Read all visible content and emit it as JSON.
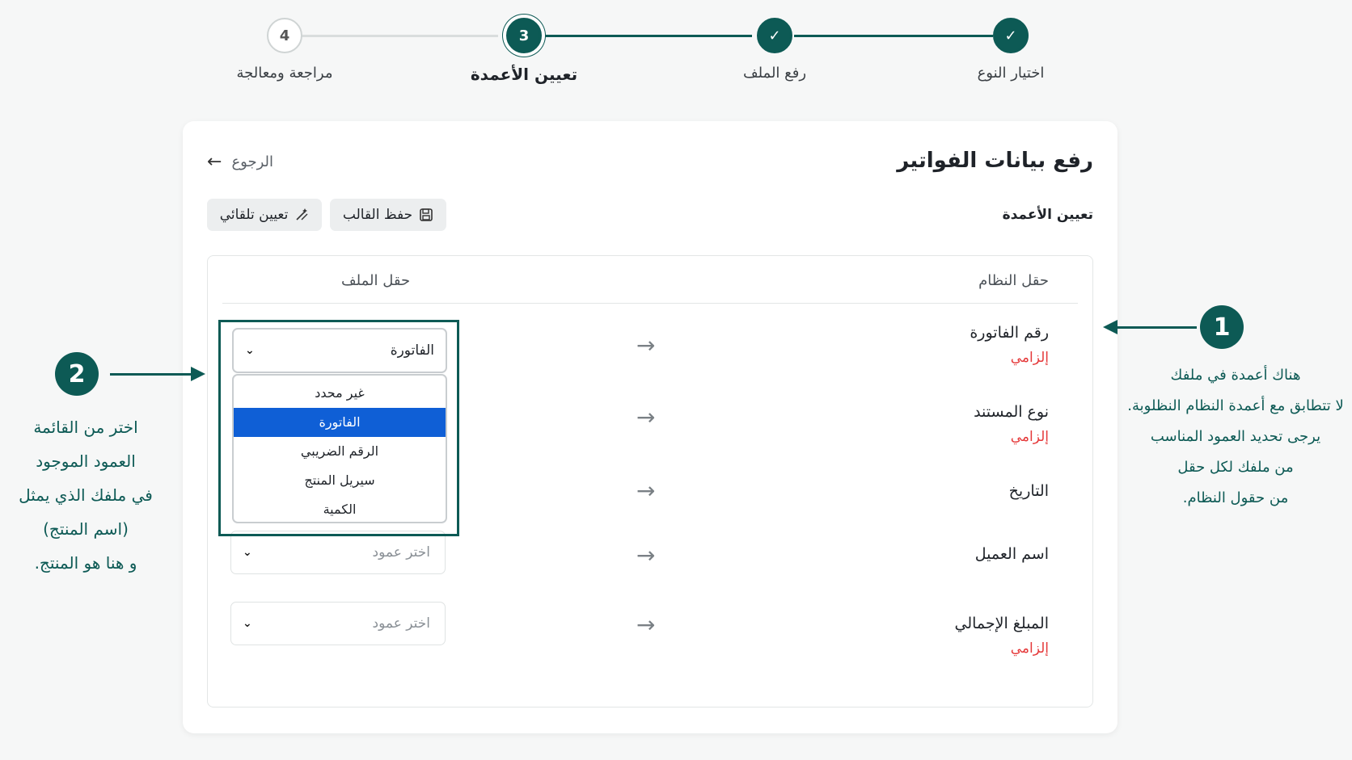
{
  "stepper": {
    "steps": [
      {
        "label": "اختيار النوع",
        "badge": "✓",
        "state": "done"
      },
      {
        "label": "رفع الملف",
        "badge": "✓",
        "state": "done"
      },
      {
        "label": "تعيين الأعمدة",
        "badge": "3",
        "state": "active"
      },
      {
        "label": "مراجعة ومعالجة",
        "badge": "4",
        "state": "todo"
      }
    ]
  },
  "page": {
    "title": "رفع بيانات الفواتير",
    "back_label": "الرجوع",
    "section_title": "تعيين الأعمدة",
    "save_template_label": "حفظ القالب",
    "auto_assign_label": "تعيين تلقائي"
  },
  "mapping": {
    "system_field_header": "حقل النظام",
    "file_field_header": "حقل الملف",
    "required_label": "إلزامي",
    "rows": [
      {
        "system_field": "رقم الفاتورة",
        "required": true,
        "selected": "الفاتورة"
      },
      {
        "system_field": "نوع المستند",
        "required": true,
        "selected": ""
      },
      {
        "system_field": "التاريخ",
        "required": false,
        "selected": ""
      },
      {
        "system_field": "اسم العميل",
        "required": false,
        "selected": ""
      },
      {
        "system_field": "المبلغ الإجمالي",
        "required": true,
        "selected": ""
      }
    ],
    "select_placeholder": "اختر عمود",
    "dropdown_options": [
      "غير محدد",
      "الفاتورة",
      "الرقم الضريبي",
      "سيريل المنتج",
      "الكمية"
    ],
    "dropdown_selected_option": "الفاتورة"
  },
  "annotations": {
    "one": {
      "number": "1",
      "lines": [
        "هناك أعمدة في ملفك",
        "لا تتطابق مع أعمدة النظام النظلوبة.",
        "يرجى تحديد العمود المناسب",
        "من ملفك لكل حقل",
        "من حقول النظام."
      ]
    },
    "two": {
      "number": "2",
      "lines": [
        "اختر من القائمة",
        "العمود الموجود",
        "في ملفك الذي يمثل",
        "(اسم المنتج)",
        "و هنا هو المنتج."
      ]
    }
  },
  "colors": {
    "brand": "#0d5a55",
    "required": "#e5393a",
    "selected_option": "#0f5fd6"
  }
}
